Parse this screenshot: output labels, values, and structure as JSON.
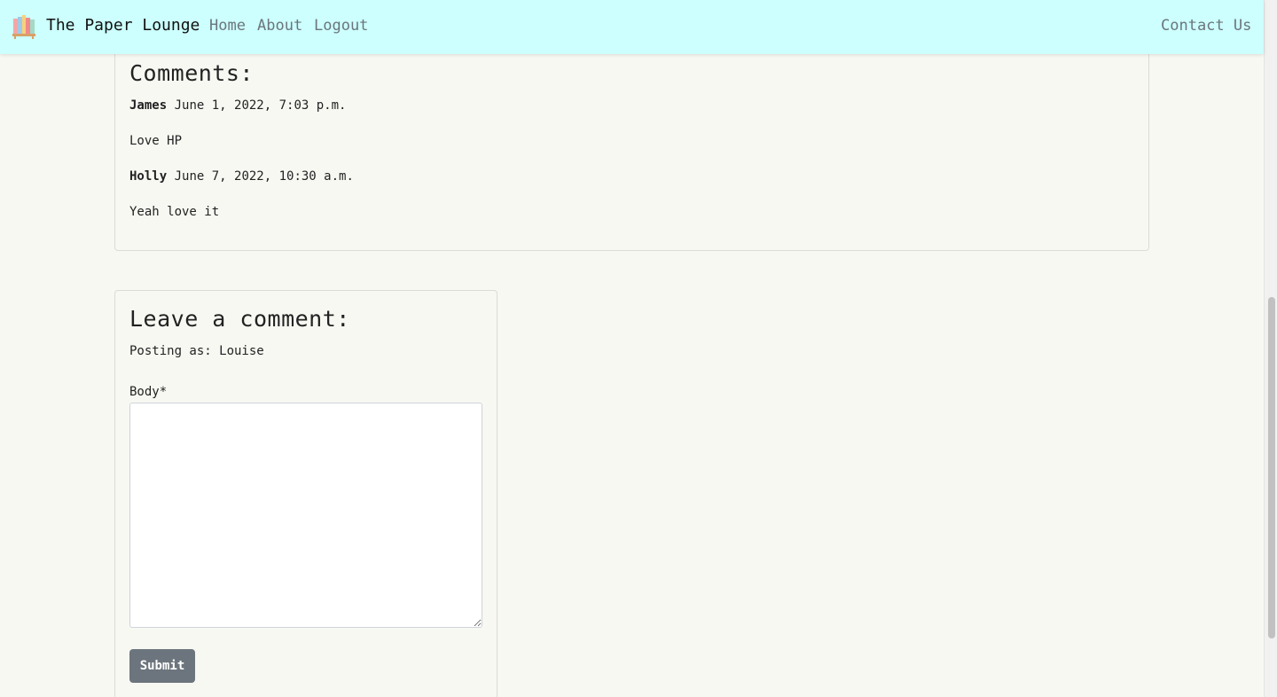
{
  "navbar": {
    "brand": "The Paper Lounge",
    "brand_icon": "books-icon",
    "links": [
      "Home",
      "About",
      "Logout"
    ],
    "contact": "Contact Us",
    "background": "#ccfffd"
  },
  "comments": {
    "heading": "Comments:",
    "items": [
      {
        "author": "James",
        "date": "June 1, 2022, 7:03 p.m.",
        "body": "Love HP"
      },
      {
        "author": "Holly",
        "date": "June 7, 2022, 10:30 a.m.",
        "body": "Yeah love it"
      }
    ]
  },
  "form": {
    "heading": "Leave a comment:",
    "posting_as": "Posting as: Louise",
    "body_label": "Body*",
    "body_value": "",
    "submit_label": "Submit"
  },
  "colors": {
    "page_bg": "#f8f8f3",
    "button": "#6c757d"
  }
}
